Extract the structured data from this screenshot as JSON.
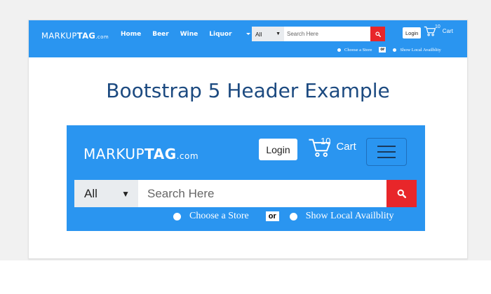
{
  "colors": {
    "brand_blue": "#2a95f0",
    "search_red": "#e8262a",
    "heading_blue": "#1c4a80",
    "page_bg": "#f1f1f1"
  },
  "top_nav": {
    "logo_main": "MARKUP",
    "logo_bold": "TAG",
    "logo_domain": ".com",
    "links": [
      "Home",
      "Beer",
      "Wine",
      "Liquor"
    ],
    "search": {
      "select_value": "All",
      "placeholder": "Search Here",
      "button_icon": "search-icon"
    },
    "radio_store": "Choose a Store",
    "or_label": "or",
    "radio_local": "Show Local Availblity",
    "login_label": "Login",
    "cart_count": "10",
    "cart_label": "Cart",
    "cart_icon": "cart-icon"
  },
  "heading": "Bootstrap 5 Header Example",
  "mobile_header": {
    "logo_main": "MARKUP",
    "logo_bold": "TAG",
    "logo_domain": ".com",
    "login_label": "Login",
    "cart_count": "10",
    "cart_label": "Cart",
    "cart_icon": "cart-icon",
    "menu_icon": "hamburger-menu-icon",
    "search": {
      "select_value": "All",
      "placeholder": "Search Here",
      "button_icon": "search-icon"
    },
    "radio_store": "Choose a Store",
    "or_label": "or",
    "radio_local": "Show Local Availblity"
  }
}
